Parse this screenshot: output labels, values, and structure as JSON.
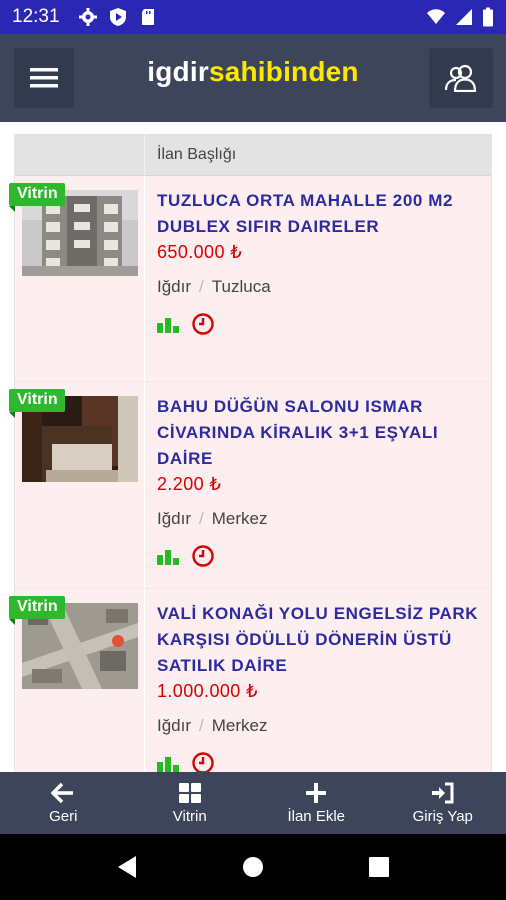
{
  "status_bar": {
    "time": "12:31"
  },
  "app": {
    "logo_part1": "igdir",
    "logo_part2": "sahibinden"
  },
  "table": {
    "header_title": "İlan Başlığı"
  },
  "listings": [
    {
      "badge": "Vitrin",
      "title": "TUZLUCA ORTA MAHALLE 200 M2 DUBLEX SIFIR DAIRELER",
      "price": "650.000 ₺",
      "city": "Iğdır",
      "district": "Tuzluca",
      "separator": "/"
    },
    {
      "badge": "Vitrin",
      "title": "BAHU DÜĞÜN SALONU ISMAR CİVARINDA KİRALIK 3+1 EŞYALI DAİRE",
      "price": "2.200 ₺",
      "city": "Iğdır",
      "district": "Merkez",
      "separator": "/"
    },
    {
      "badge": "Vitrin",
      "title": "VALİ KONAĞI YOLU ENGELSİZ PARK KARŞISI ÖDÜLLÜ DÖNERİN ÜSTÜ SATILIK DAİRE",
      "price": "1.000.000 ₺",
      "city": "Iğdır",
      "district": "Merkez",
      "separator": "/"
    }
  ],
  "bottom_nav": {
    "back": "Geri",
    "showcase": "Vitrin",
    "add": "İlan Ekle",
    "login": "Giriş Yap"
  },
  "colors": {
    "status_bar": "#2a27b3",
    "app_bar": "#3d455a",
    "logo_accent": "#ffe800",
    "badge": "#2eb82e",
    "title": "#2c2ca0",
    "price": "#d90000",
    "row_bg": "#fdeef0"
  }
}
